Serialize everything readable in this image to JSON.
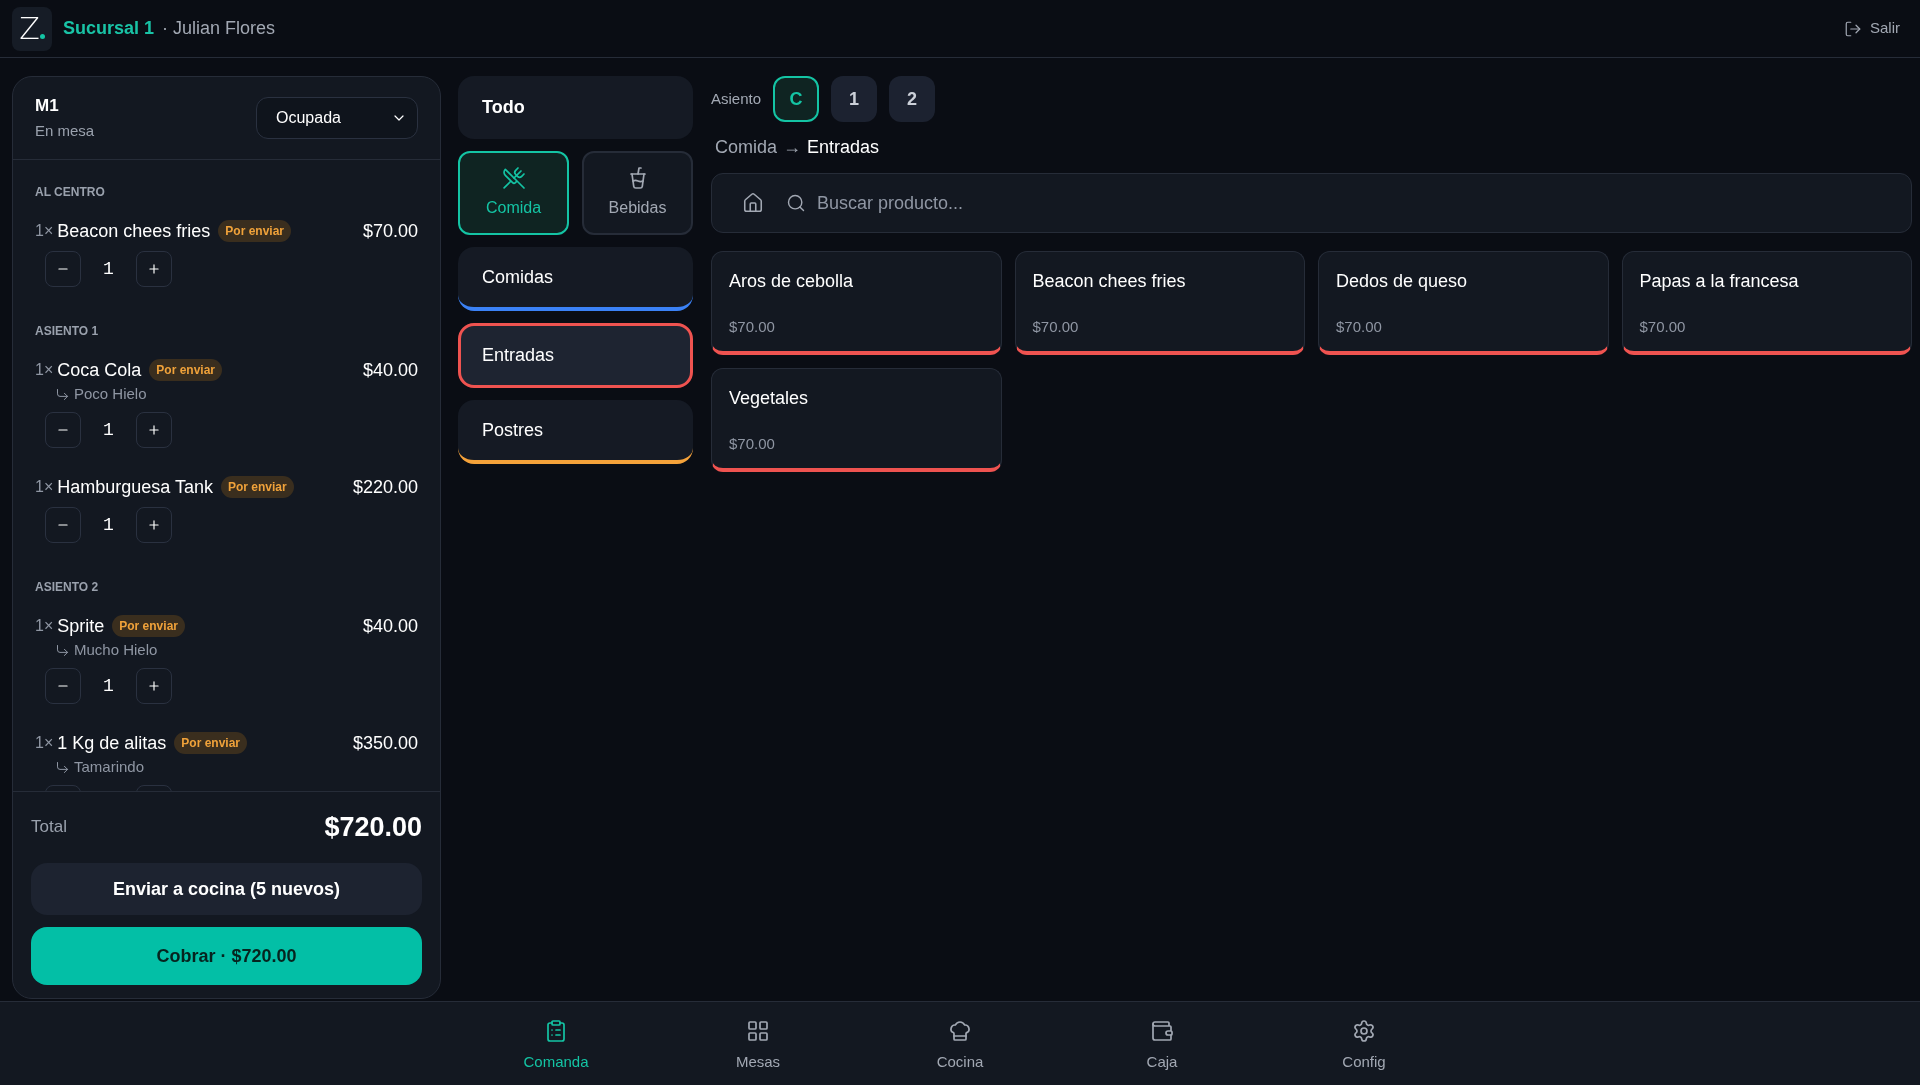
{
  "header": {
    "logo": "Z",
    "branch": "Sucursal 1",
    "user": "· Julian Flores",
    "logout": "Salir"
  },
  "order": {
    "table": "M1",
    "mode": "En mesa",
    "status_select": {
      "value": "Ocupada"
    },
    "sections": [
      {
        "title": "AL CENTRO",
        "items": [
          {
            "qty_prefix": "1×",
            "name": "Beacon chees fries",
            "badge": "Por enviar",
            "price": "$70.00",
            "quantity": "1"
          }
        ]
      },
      {
        "title": "ASIENTO 1",
        "items": [
          {
            "qty_prefix": "1×",
            "name": "Coca Cola",
            "badge": "Por enviar",
            "price": "$40.00",
            "note": "Poco Hielo",
            "quantity": "1"
          },
          {
            "qty_prefix": "1×",
            "name": "Hamburguesa Tank",
            "badge": "Por enviar",
            "price": "$220.00",
            "quantity": "1"
          }
        ]
      },
      {
        "title": "ASIENTO 2",
        "items": [
          {
            "qty_prefix": "1×",
            "name": "Sprite",
            "badge": "Por enviar",
            "price": "$40.00",
            "note": "Mucho Hielo",
            "quantity": "1"
          },
          {
            "qty_prefix": "1×",
            "name": "1 Kg de alitas",
            "badge": "Por enviar",
            "price": "$350.00",
            "note": "Tamarindo"
          }
        ]
      }
    ],
    "total_label": "Total",
    "total": "$720.00",
    "send_button": "Enviar a cocina (5 nuevos)",
    "charge_button": "Cobrar · $720.00"
  },
  "catalog": {
    "all_button": {
      "label": "Todo",
      "selected": false
    },
    "groups": [
      {
        "label": "Comida",
        "selected": true
      },
      {
        "label": "Bebidas",
        "selected": false
      }
    ],
    "categories": [
      {
        "label": "Comidas",
        "color": "#3b82f6",
        "selected": false
      },
      {
        "label": "Entradas",
        "color": "#ef5350",
        "selected": true
      },
      {
        "label": "Postres",
        "color": "#f5a23a",
        "selected": false
      }
    ]
  },
  "seats": {
    "label": "Asiento",
    "options": [
      {
        "label": "C",
        "selected": true
      },
      {
        "label": "1",
        "selected": false
      },
      {
        "label": "2",
        "selected": false
      }
    ]
  },
  "breadcrumb": {
    "parent": "Comida",
    "separator": "→",
    "current": "Entradas"
  },
  "search": {
    "placeholder": "Buscar producto..."
  },
  "products": [
    {
      "name": "Aros de cebolla",
      "price": "$70.00"
    },
    {
      "name": "Beacon chees fries",
      "price": "$70.00"
    },
    {
      "name": "Dedos de queso",
      "price": "$70.00"
    },
    {
      "name": "Papas a la francesa",
      "price": "$70.00"
    },
    {
      "name": "Vegetales",
      "price": "$70.00"
    }
  ],
  "nav": [
    {
      "label": "Comanda",
      "selected": true
    },
    {
      "label": "Mesas",
      "selected": false
    },
    {
      "label": "Cocina",
      "selected": false
    },
    {
      "label": "Caja",
      "selected": false
    },
    {
      "label": "Config",
      "selected": false
    }
  ]
}
